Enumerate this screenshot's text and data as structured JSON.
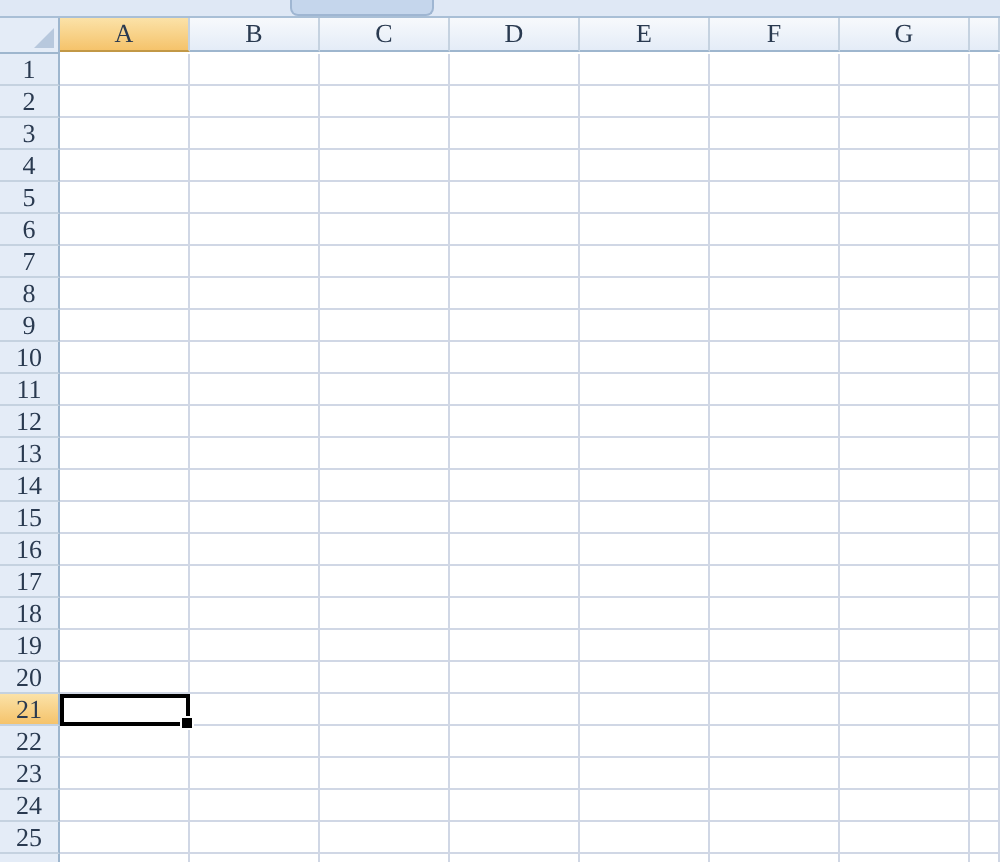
{
  "columns": [
    {
      "label": "A",
      "selected": true
    },
    {
      "label": "B",
      "selected": false
    },
    {
      "label": "C",
      "selected": false
    },
    {
      "label": "D",
      "selected": false
    },
    {
      "label": "E",
      "selected": false
    },
    {
      "label": "F",
      "selected": false
    },
    {
      "label": "G",
      "selected": false
    }
  ],
  "rows": [
    {
      "label": "1",
      "selected": false
    },
    {
      "label": "2",
      "selected": false
    },
    {
      "label": "3",
      "selected": false
    },
    {
      "label": "4",
      "selected": false
    },
    {
      "label": "5",
      "selected": false
    },
    {
      "label": "6",
      "selected": false
    },
    {
      "label": "7",
      "selected": false
    },
    {
      "label": "8",
      "selected": false
    },
    {
      "label": "9",
      "selected": false
    },
    {
      "label": "10",
      "selected": false
    },
    {
      "label": "11",
      "selected": false
    },
    {
      "label": "12",
      "selected": false
    },
    {
      "label": "13",
      "selected": false
    },
    {
      "label": "14",
      "selected": false
    },
    {
      "label": "15",
      "selected": false
    },
    {
      "label": "16",
      "selected": false
    },
    {
      "label": "17",
      "selected": false
    },
    {
      "label": "18",
      "selected": false
    },
    {
      "label": "19",
      "selected": false
    },
    {
      "label": "20",
      "selected": false
    },
    {
      "label": "21",
      "selected": true
    },
    {
      "label": "22",
      "selected": false
    },
    {
      "label": "23",
      "selected": false
    },
    {
      "label": "24",
      "selected": false
    },
    {
      "label": "25",
      "selected": false
    }
  ]
}
